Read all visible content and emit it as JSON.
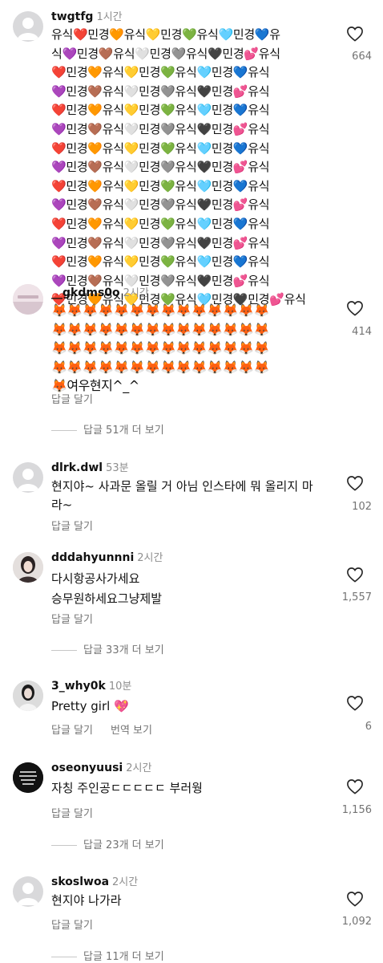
{
  "comments": [
    {
      "username": "twgtfg",
      "time": "1시간",
      "lines": [
        "유식❤️민경🧡유식💛민경💚유식🩵민경💙유",
        "식💜민경🤎유식🤍민경🩶유식🖤민경💕유식",
        "❤️민경🧡유식💛민경💚유식🩵민경💙유식",
        "💜민경🤎유식🤍민경🩶유식🖤민경💕유식",
        "❤️민경🧡유식💛민경💚유식🩵민경💙유식",
        "💜민경🤎유식🤍민경🩶유식🖤민경💕유식",
        "❤️민경🧡유식💛민경💚유식🩵민경💙유식",
        "💜민경🤎유식🤍민경🩶유식🖤민경💕유식",
        "❤️민경🧡유식💛민경💚유식🩵민경💙유식",
        "💜민경🤎유식🤍민경🩶유식🖤민경💕유식",
        "❤️민경🧡유식💛민경💚유식🩵민경💙유식",
        "💜민경🤎유식🤍민경🩶유식🖤민경💕유식",
        "❤️민경🧡유식💛민경💚유식🩵민경💙유식",
        "💜민경🤎유식🤍민경🩶유식🖤민경💕유식",
        "❤️민경🧡유식💛민경💚유식🩵민경🖤민경💕유식"
      ],
      "likes": "664"
    },
    {
      "username": "__gkdms0o",
      "time": "2시간",
      "lines": [
        "🦊🦊🦊🦊🦊🦊🦊🦊🦊🦊🦊🦊🦊🦊",
        "🦊🦊🦊🦊🦊🦊🦊🦊🦊🦊🦊🦊🦊🦊",
        "🦊🦊🦊🦊🦊🦊🦊🦊🦊🦊🦊🦊🦊🦊",
        "🦊🦊🦊🦊🦊🦊🦊🦊🦊🦊🦊🦊🦊🦊",
        "🦊여우현지^_^"
      ],
      "reply": "답글 달기",
      "likes": "414",
      "more": "답글 51개 더 보기"
    },
    {
      "username": "dlrk.dwl",
      "time": "53분",
      "lines": [
        "현지야~ 사과문 올릴 거 아님 인스타에 뭐 올리지 마",
        "라~"
      ],
      "reply": "답글 달기",
      "likes": "102"
    },
    {
      "username": "dddahyunnni",
      "time": "2시간",
      "lines": [
        "다시항공사가세요",
        "승무원하세요그냥제발"
      ],
      "reply": "답글 달기",
      "likes": "1,557",
      "more": "답글 33개 더 보기"
    },
    {
      "username": "3_why0k",
      "time": "10분",
      "lines": [
        "Pretty girl 💖"
      ],
      "reply": "답글 달기",
      "translate": "번역 보기",
      "likes": "6"
    },
    {
      "username": "oseonyuusi",
      "time": "2시간",
      "lines": [
        "자칭 주인공ㄷㄷㄷㄷㄷ 부러웡"
      ],
      "reply": "답글 달기",
      "likes": "1,156",
      "more": "답글 23개 더 보기"
    },
    {
      "username": "skoslwoa",
      "time": "2시간",
      "lines": [
        "현지야 나가라"
      ],
      "reply": "답글 달기",
      "likes": "1,092",
      "more": "답글 11개 더 보기"
    }
  ]
}
